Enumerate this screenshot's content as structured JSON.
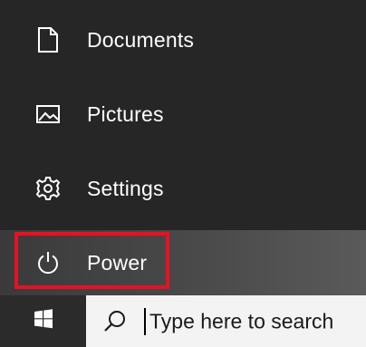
{
  "start_menu": {
    "items": [
      {
        "label": "Documents",
        "icon": "document-icon"
      },
      {
        "label": "Pictures",
        "icon": "pictures-icon"
      },
      {
        "label": "Settings",
        "icon": "gear-icon"
      },
      {
        "label": "Power",
        "icon": "power-icon"
      }
    ]
  },
  "taskbar": {
    "start_icon": "windows-logo-icon",
    "search": {
      "placeholder": "Type here to search",
      "icon": "search-icon"
    }
  },
  "colors": {
    "highlight": "#e81123",
    "menu_background": "#262626",
    "text": "#ffffff"
  }
}
